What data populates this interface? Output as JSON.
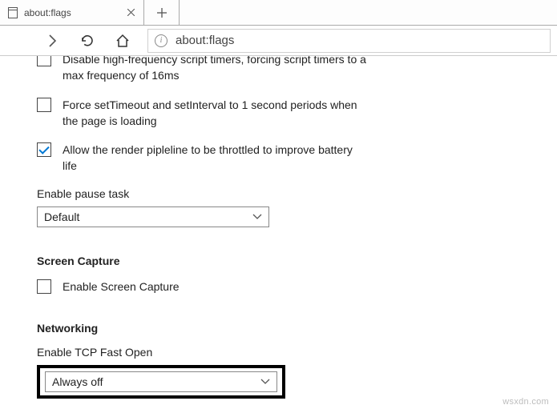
{
  "tab": {
    "title": "about:flags"
  },
  "address": {
    "url": "about:flags"
  },
  "settings": {
    "opt_high_freq": "Disable high-frequency script timers, forcing script timers to a max frequency of 16ms",
    "opt_timeout": "Force setTimeout and setInterval to 1 second periods when the page is loading",
    "opt_pipeline": "Allow the render pipleline to be throttled to improve battery life",
    "pause_label": "Enable pause task",
    "pause_value": "Default",
    "screen_section": "Screen Capture",
    "screen_enable": "Enable Screen Capture",
    "net_section": "Networking",
    "tcp_label": "Enable TCP Fast Open",
    "tcp_value": "Always off"
  },
  "watermark": "wsxdn.com"
}
